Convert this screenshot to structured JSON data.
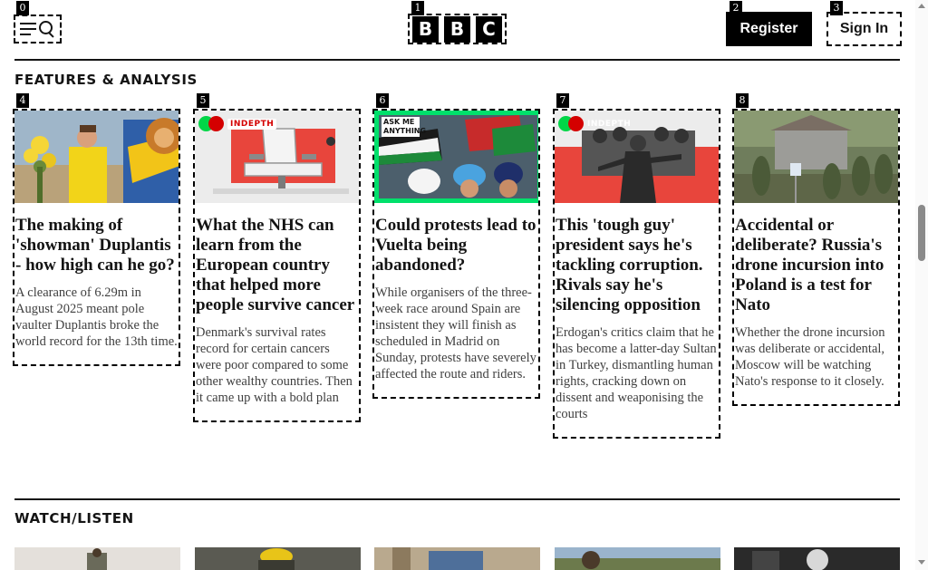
{
  "header": {
    "menu_icon": "menu-search-icon",
    "logo_letters": [
      "B",
      "B",
      "C"
    ],
    "register_label": "Register",
    "signin_label": "Sign In",
    "tags": {
      "menu": "0",
      "logo": "1",
      "register": "2",
      "signin": "3"
    }
  },
  "features": {
    "title": "FEATURES & ANALYSIS",
    "badge_label": "INDEPTH",
    "ask_badge": "ASK ME ANYTHING",
    "cards": [
      {
        "tag": "4",
        "headline": "The making of 'showman' Duplantis - how high can he go?",
        "summary": "A clearance of 6.29m in August 2025 meant pole vaulter Duplantis broke the world record for the 13th time."
      },
      {
        "tag": "5",
        "headline": "What the NHS can learn from the European country that helped more people survive cancer",
        "summary": "Denmark's survival rates record for certain cancers were poor compared to some other wealthy countries. Then it came up with a bold plan"
      },
      {
        "tag": "6",
        "headline": "Could protests lead to Vuelta being abandoned?",
        "summary": "While organisers of the three-week race around Spain are insistent they will finish as scheduled in Madrid on Sunday, protests have severely affected the route and riders."
      },
      {
        "tag": "7",
        "headline": "This 'tough guy' president says he's tackling corruption. Rivals say he's silencing opposition",
        "summary": "Erdogan's critics claim that he has become a latter-day Sultan in Turkey, dismantling human rights, cracking down on dissent and weaponising the courts"
      },
      {
        "tag": "8",
        "headline": "Accidental or deliberate? Russia's drone incursion into Poland is a test for Nato",
        "summary": "Whether the drone incursion was deliberate or accidental, Moscow will be watching Nato's response to it closely."
      }
    ]
  },
  "watch": {
    "title": "WATCH/LISTEN"
  },
  "colors": {
    "text": "#141414",
    "summary": "#3f3f3f",
    "badge_green": "#00d647",
    "badge_red": "#d40000"
  }
}
